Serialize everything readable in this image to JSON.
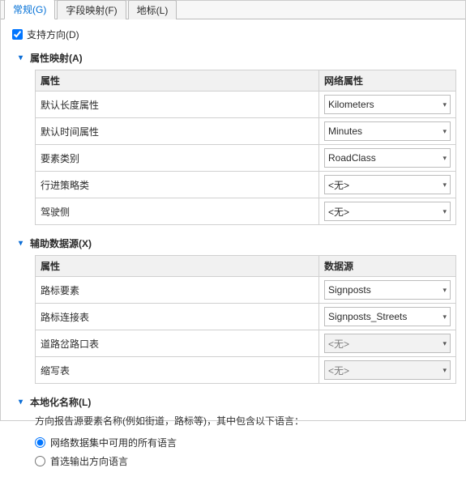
{
  "tabs": {
    "general": "常规(G)",
    "fieldMapping": "字段映射(F)",
    "landmarks": "地标(L)"
  },
  "supportsDirections": "支持方向(D)",
  "sections": {
    "attrMap": "属性映射(A)",
    "aux": "辅助数据源(X)",
    "localized": "本地化名称(L)"
  },
  "headers": {
    "attribute": "属性",
    "networkAttribute": "网络属性",
    "dataSource": "数据源"
  },
  "attrMap": [
    {
      "label": "默认长度属性",
      "value": "Kilometers",
      "disabled": false
    },
    {
      "label": "默认时间属性",
      "value": "Minutes",
      "disabled": false
    },
    {
      "label": "要素类别",
      "value": "RoadClass",
      "disabled": false
    },
    {
      "label": "行进策略类",
      "value": "<无>",
      "disabled": false
    },
    {
      "label": "驾驶侧",
      "value": "<无>",
      "disabled": false
    }
  ],
  "aux": [
    {
      "label": "路标要素",
      "value": "Signposts",
      "disabled": false
    },
    {
      "label": "路标连接表",
      "value": "Signposts_Streets",
      "disabled": false
    },
    {
      "label": "道路岔路口表",
      "value": "<无>",
      "disabled": true
    },
    {
      "label": "缩写表",
      "value": "<无>",
      "disabled": true
    }
  ],
  "localized": {
    "helper": "方向报告源要素名称(例如街道，路标等)，其中包含以下语言：",
    "opt1": "网络数据集中可用的所有语言",
    "opt2": "首选输出方向语言"
  }
}
